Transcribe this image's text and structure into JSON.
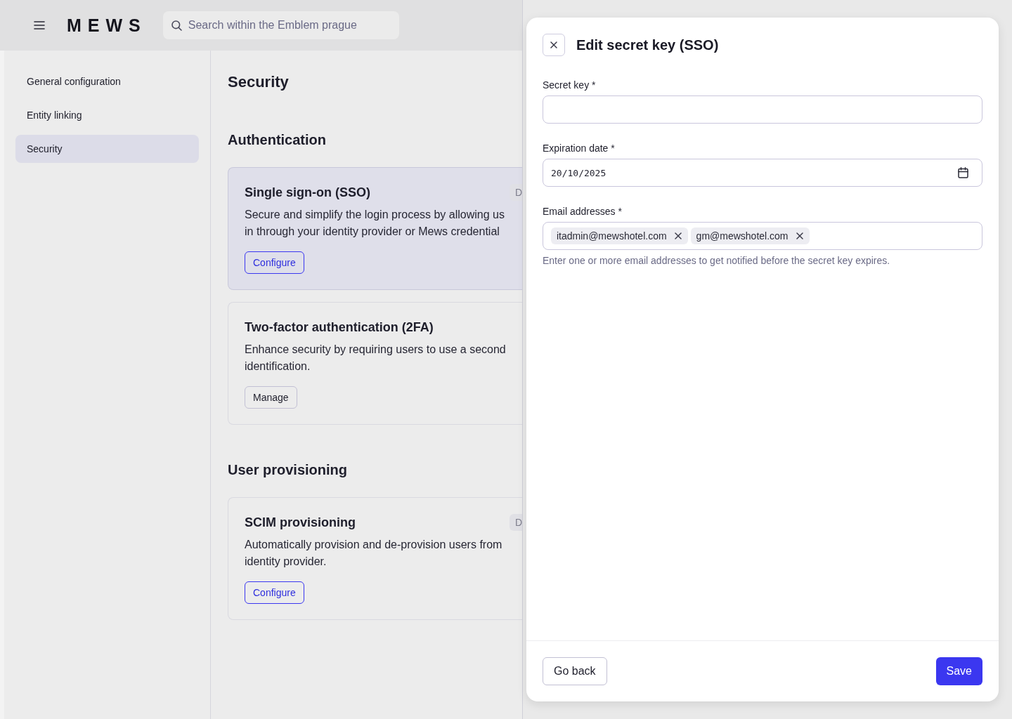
{
  "top_bar": {
    "logo": "MEWS",
    "search": {
      "placeholder": "Search within the Emblem prague"
    }
  },
  "sidebar": {
    "items": [
      {
        "label": "General configuration",
        "selected": false
      },
      {
        "label": "Entity linking",
        "selected": false
      },
      {
        "label": "Security",
        "selected": true
      }
    ]
  },
  "main": {
    "title": "Security",
    "sections": [
      {
        "heading": "Authentication",
        "cards": [
          {
            "title": "Single sign-on (SSO)",
            "badge": "D",
            "active": true,
            "description": [
              "Secure and simplify the login process by allowing us",
              "in through your identity provider or Mews credential"
            ],
            "button": {
              "label": "Configure",
              "kind": "outline"
            }
          },
          {
            "title": "Two-factor authentication (2FA)",
            "active": false,
            "description": [
              "Enhance security by requiring users to use a second",
              "identification."
            ],
            "button": {
              "label": "Manage",
              "kind": "secondary"
            }
          }
        ]
      },
      {
        "heading": "User provisioning",
        "cards": [
          {
            "title": "SCIM provisioning",
            "badge": "D",
            "active": false,
            "description": [
              "Automatically provision and de-provision users from",
              "identity provider."
            ],
            "button": {
              "label": "Configure",
              "kind": "outline"
            }
          }
        ]
      }
    ]
  },
  "dialog": {
    "title": "Edit secret key (SSO)",
    "fields": [
      {
        "kind": "text",
        "label": "Secret key *"
      },
      {
        "kind": "date",
        "label": "Expiration date *",
        "value": "20/10/2025"
      },
      {
        "kind": "tags",
        "label": "Email addresses *",
        "tags": [
          "itadmin@mewshotel.com",
          "gm@mewshotel.com"
        ],
        "hint": "Enter one or more email addresses to get notified before the secret key expires."
      }
    ],
    "buttons": [
      {
        "label": "Go back",
        "kind": "secondary"
      },
      {
        "label": "Save",
        "kind": "primary"
      }
    ]
  }
}
